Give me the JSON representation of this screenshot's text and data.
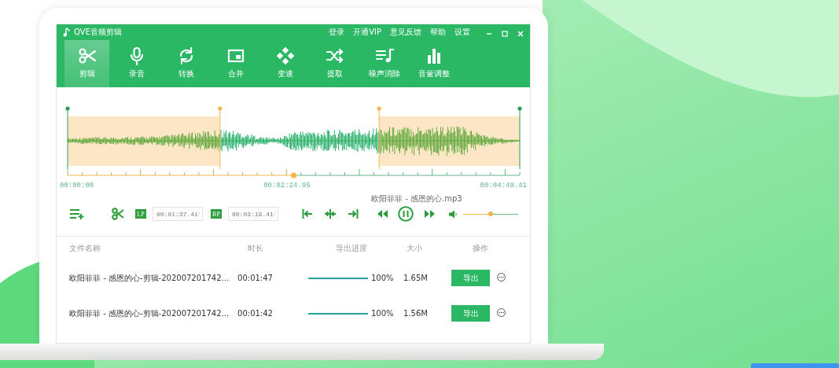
{
  "window": {
    "title": "QVE音频剪辑"
  },
  "menu": [
    "登录",
    "开通VIP",
    "意见反馈",
    "帮助",
    "设置"
  ],
  "tools": [
    {
      "kind": "scissors",
      "label": "剪辑",
      "selected": true
    },
    {
      "kind": "mic",
      "label": "录音",
      "selected": false
    },
    {
      "kind": "convert",
      "label": "转换",
      "selected": false
    },
    {
      "kind": "merge",
      "label": "合并",
      "selected": false
    },
    {
      "kind": "speed",
      "label": "变速",
      "selected": false
    },
    {
      "kind": "extract",
      "label": "提取",
      "selected": false
    },
    {
      "kind": "denoise",
      "label": "噪声消除",
      "selected": false
    },
    {
      "kind": "volume",
      "label": "音量调整",
      "selected": false
    }
  ],
  "editor": {
    "start_time": "00:00:00",
    "playhead_time": "00:02:24.95",
    "end_time": "00:04:49.41",
    "playhead": {
      "level": 0.5
    },
    "trim": [
      {
        "kind": "start",
        "level": 0.337
      },
      {
        "kind": "end",
        "level": 0.689
      }
    ]
  },
  "controls": {
    "file_name": "欧阳菲菲 - 感恩的心.mp3",
    "playing": true,
    "points": [
      {
        "badge": "LP",
        "value": "00:01:37.41"
      },
      {
        "badge": "RP",
        "value": "00:03:19.41"
      }
    ],
    "volume": {
      "level": 0.5
    }
  },
  "table": {
    "columns": [
      "文件名称",
      "时长",
      "导出进度",
      "大小",
      "操作"
    ],
    "rows": [
      {
        "name": "欧阳菲菲 - 感恩的心-剪辑-202007201742...",
        "duration": "00:01:47",
        "progress": {
          "level": 1
        },
        "percent": "100%",
        "size": "1.65M",
        "action": "导出"
      },
      {
        "name": "欧阳菲菲 - 感恩的心-剪辑-202007201742...",
        "duration": "00:01:42",
        "progress": {
          "level": 1
        },
        "percent": "100%",
        "size": "1.56M",
        "action": "导出"
      }
    ]
  }
}
